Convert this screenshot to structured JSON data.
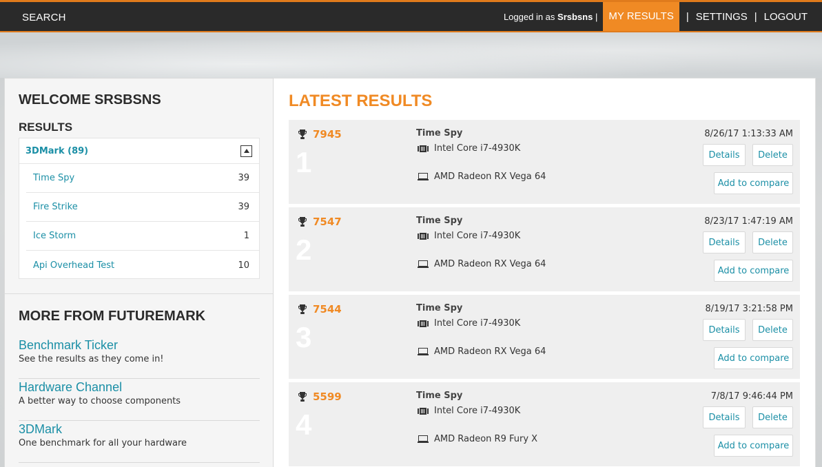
{
  "topbar": {
    "search": "SEARCH",
    "logged_prefix": "Logged in as",
    "username": "Srsbsns",
    "logged_sep": "|",
    "my_results": "MY RESULTS",
    "settings": "SETTINGS",
    "logout": "LOGOUT",
    "sep": "|"
  },
  "sidebar": {
    "welcome": "WELCOME SRSBSNS",
    "results_title": "RESULTS",
    "group": {
      "label": "3DMark (89)"
    },
    "items": [
      {
        "label": "Time Spy",
        "count": "39"
      },
      {
        "label": "Fire Strike",
        "count": "39"
      },
      {
        "label": "Ice Storm",
        "count": "1"
      },
      {
        "label": "Api Overhead Test",
        "count": "10"
      }
    ],
    "more_title": "MORE FROM FUTUREMARK",
    "more": [
      {
        "title": "Benchmark Ticker",
        "desc": "See the results as they come in!"
      },
      {
        "title": "Hardware Channel",
        "desc": "A better way to choose components"
      },
      {
        "title": "3DMark",
        "desc": "One benchmark for all your hardware"
      }
    ]
  },
  "main": {
    "title": "LATEST RESULTS",
    "buttons": {
      "details": "Details",
      "delete": "Delete",
      "compare": "Add to compare"
    },
    "results": [
      {
        "rank": "1",
        "score": "7945",
        "test": "Time Spy",
        "cpu": "Intel Core i7-4930K",
        "gpu": "AMD Radeon RX Vega 64",
        "date": "8/26/17 1:13:33 AM"
      },
      {
        "rank": "2",
        "score": "7547",
        "test": "Time Spy",
        "cpu": "Intel Core i7-4930K",
        "gpu": "AMD Radeon RX Vega 64",
        "date": "8/23/17 1:47:19 AM"
      },
      {
        "rank": "3",
        "score": "7544",
        "test": "Time Spy",
        "cpu": "Intel Core i7-4930K",
        "gpu": "AMD Radeon RX Vega 64",
        "date": "8/19/17 3:21:58 PM"
      },
      {
        "rank": "4",
        "score": "5599",
        "test": "Time Spy",
        "cpu": "Intel Core i7-4930K",
        "gpu": "AMD Radeon R9 Fury X",
        "date": "7/8/17 9:46:44 PM"
      }
    ]
  },
  "colors": {
    "accent": "#f08a24",
    "link": "#1b8fa6",
    "topbar": "#2a2a2a"
  }
}
